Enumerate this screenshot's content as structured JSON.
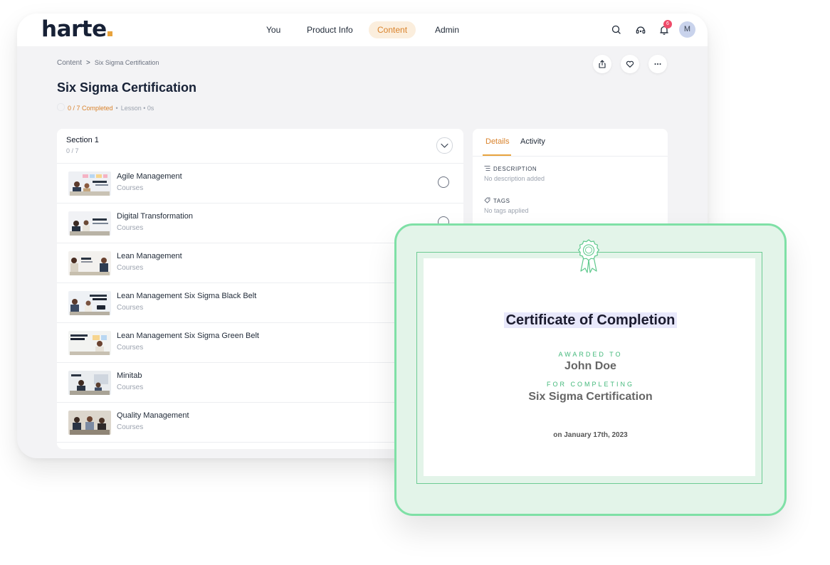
{
  "header": {
    "logo": "harte",
    "nav": [
      "You",
      "Product Info",
      "Content",
      "Admin"
    ],
    "active_nav": "Content",
    "notification_count": "6",
    "avatar_initial": "M"
  },
  "breadcrumb": {
    "root": "Content",
    "separator": ">",
    "current": "Six Sigma Certification"
  },
  "page": {
    "title": "Six Sigma Certification",
    "progress": "0 / 7 Completed",
    "meta": "Lesson • 0s"
  },
  "section": {
    "title": "Section 1",
    "count": "0 / 7"
  },
  "courses": [
    {
      "title": "Agile Management",
      "type": "Courses"
    },
    {
      "title": "Digital Transformation",
      "type": "Courses"
    },
    {
      "title": "Lean Management",
      "type": "Courses"
    },
    {
      "title": "Lean Management Six Sigma Black Belt",
      "type": "Courses"
    },
    {
      "title": "Lean Management Six Sigma Green Belt",
      "type": "Courses"
    },
    {
      "title": "Minitab",
      "type": "Courses"
    },
    {
      "title": "Quality Management",
      "type": "Courses"
    }
  ],
  "details": {
    "tabs": [
      "Details",
      "Activity"
    ],
    "description_label": "DESCRIPTION",
    "description_value": "No description added",
    "tags_label": "TAGS",
    "tags_value": "No tags applied"
  },
  "certificate": {
    "title": "Certificate of Completion",
    "awarded_label": "AWARDED TO",
    "recipient": "John Doe",
    "for_label": "FOR COMPLETING",
    "course": "Six Sigma Certification",
    "date": "on January 17th, 2023"
  },
  "colors": {
    "accent": "#e8a33d",
    "brand_dark": "#172136",
    "certificate_green": "#7fe0a6",
    "certificate_bg": "#e3f4e9"
  }
}
